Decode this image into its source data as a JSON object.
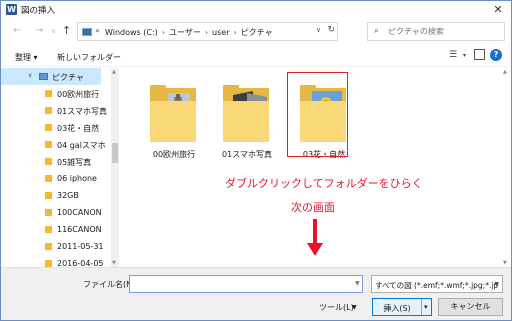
{
  "window": {
    "title": "図の挿入",
    "app_icon_letter": "W",
    "close_symbol": "✕"
  },
  "nav": {
    "back_symbol": "←",
    "forward_symbol": "→",
    "recent_symbol": "∨",
    "up_symbol": "↑",
    "address_prefix": "«",
    "path": [
      "Windows (C:)",
      "ユーザー",
      "user",
      "ピクチャ"
    ],
    "path_separator": "›",
    "address_dropdown_symbol": "∨",
    "refresh_symbol": "↻",
    "search_placeholder": "ピクチャの検索"
  },
  "toolbar": {
    "organize_label": "整理 ▾",
    "new_folder_label": "新しいフォルダー",
    "view_icon": "view-list-icon",
    "help_label": "?"
  },
  "sidebar": {
    "items": [
      {
        "label": "ピクチャ",
        "kind": "pictures",
        "selected": true
      },
      {
        "label": "00欧州旅行",
        "kind": "folder"
      },
      {
        "label": "01スマホ写真",
        "kind": "folder"
      },
      {
        "label": "03花・自然",
        "kind": "folder"
      },
      {
        "label": "04 galスマホ",
        "kind": "folder"
      },
      {
        "label": "05雑写真",
        "kind": "folder"
      },
      {
        "label": "06 iphone",
        "kind": "folder"
      },
      {
        "label": "32GB",
        "kind": "folder"
      },
      {
        "label": "100CANON",
        "kind": "folder"
      },
      {
        "label": "116CANON",
        "kind": "folder"
      },
      {
        "label": "2011-05-31",
        "kind": "folder"
      },
      {
        "label": "2016-04-05",
        "kind": "folder"
      }
    ]
  },
  "files": [
    {
      "label": "00欧州旅行",
      "selected": false
    },
    {
      "label": "01スマホ写真",
      "selected": false
    },
    {
      "label": "03花・自然",
      "selected": true
    }
  ],
  "annotation": {
    "line1": "ダブルクリックしてフォルダーをひらく",
    "line2": "次の画面",
    "color": "#e8142e"
  },
  "bottom": {
    "filename_label": "ファイル名(N):",
    "filename_value": "",
    "filetype_value": "すべての図 (*.emf;*.wmf;*.jpg;*.jp",
    "tools_label": "ツール(L)",
    "insert_label": "挿入(S)",
    "insert_dropdown_symbol": "▾",
    "cancel_label": "キャンセル"
  },
  "colors": {
    "accent": "#0078d7",
    "selection": "#cce8ff",
    "folder": "#f9d877",
    "highlight_border": "#e02424"
  }
}
